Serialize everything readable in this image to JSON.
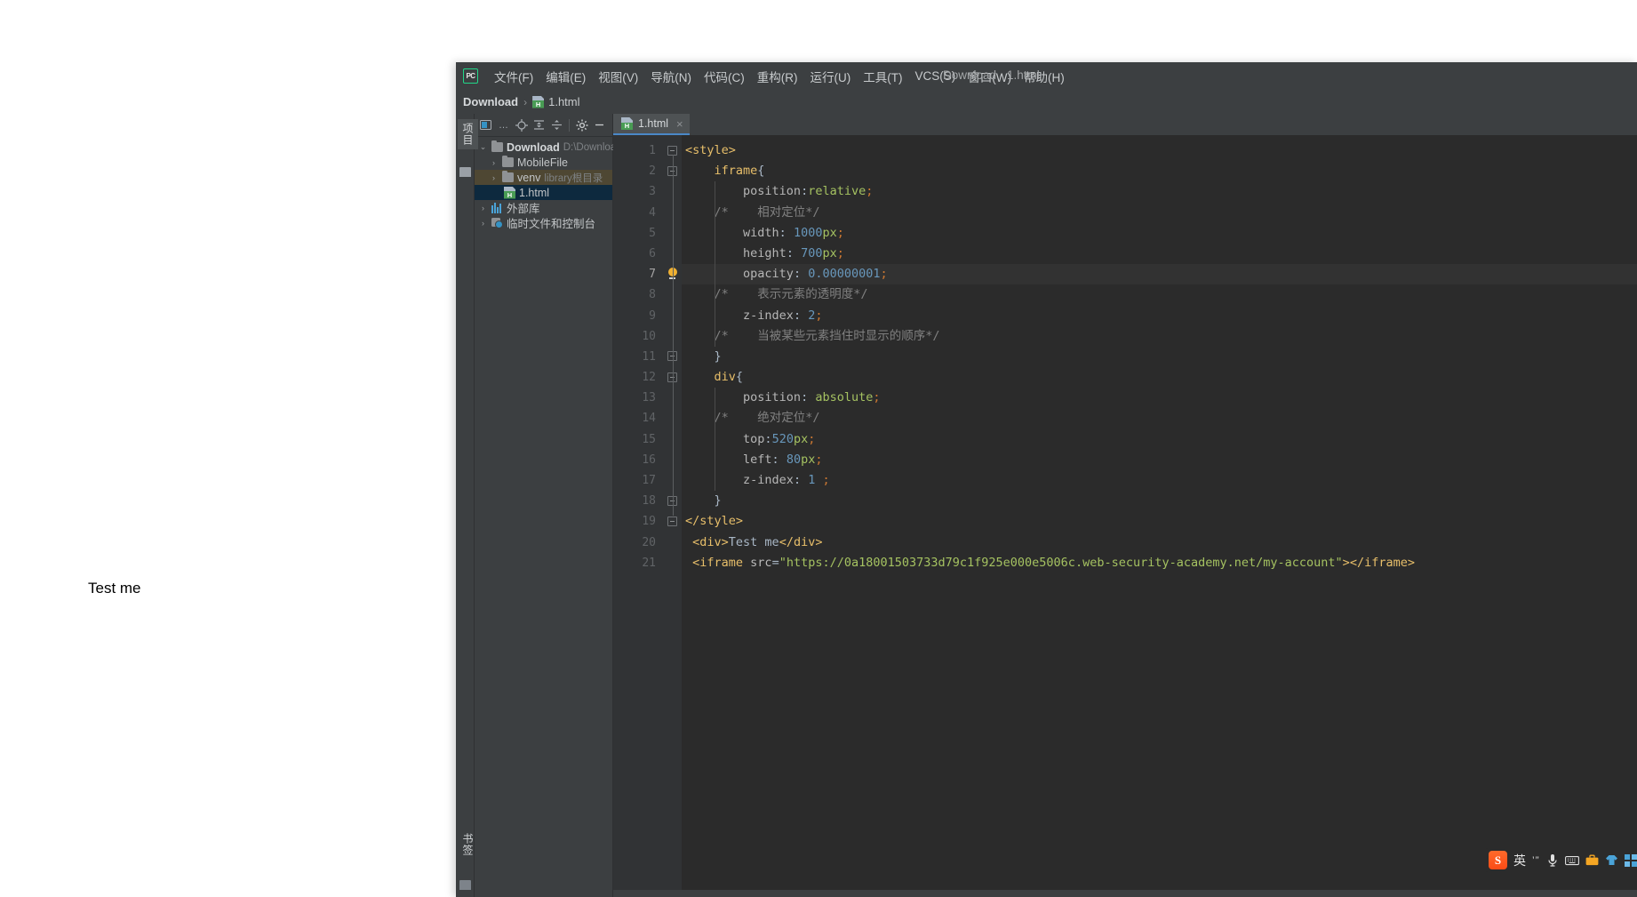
{
  "background_page": {
    "text": "Test me"
  },
  "window": {
    "title": "Download - 1.html",
    "app_logo": "PC"
  },
  "menubar": {
    "items": [
      {
        "label": "文件(F)",
        "name": "menu-file"
      },
      {
        "label": "编辑(E)",
        "name": "menu-edit"
      },
      {
        "label": "视图(V)",
        "name": "menu-view"
      },
      {
        "label": "导航(N)",
        "name": "menu-navigate"
      },
      {
        "label": "代码(C)",
        "name": "menu-code"
      },
      {
        "label": "重构(R)",
        "name": "menu-refactor"
      },
      {
        "label": "运行(U)",
        "name": "menu-run"
      },
      {
        "label": "工具(T)",
        "name": "menu-tools"
      },
      {
        "label": "VCS(S)",
        "name": "menu-vcs"
      },
      {
        "label": "窗口(W)",
        "name": "menu-window"
      },
      {
        "label": "帮助(H)",
        "name": "menu-help"
      }
    ]
  },
  "breadcrumb": {
    "root": "Download",
    "separator": "›",
    "file": "1.html"
  },
  "toolstrip": {
    "project_tab": "项目",
    "bookmarks_tab": "书签"
  },
  "project_panel": {
    "toolbar_icons": [
      "select-opened-file-icon",
      "ellipsis-icon",
      "locate-icon",
      "expand-all-icon",
      "collapse-all-icon",
      "settings-gear-icon",
      "hide-panel-icon"
    ],
    "tree": [
      {
        "label": "Download",
        "hint": "D:\\Download",
        "arrow": "⌄",
        "icon": "folder-icon",
        "state": "expanded",
        "bold": true,
        "indent": 0
      },
      {
        "label": "MobileFile",
        "hint": "",
        "arrow": "›",
        "icon": "folder-icon",
        "state": "collapsed",
        "bold": false,
        "indent": 1
      },
      {
        "label": "venv",
        "hint": "library根目录",
        "arrow": "›",
        "icon": "folder-icon",
        "state": "collapsed",
        "bold": false,
        "indent": 1,
        "highlight": true
      },
      {
        "label": "1.html",
        "hint": "",
        "arrow": "",
        "icon": "html-file-icon",
        "state": "selected",
        "bold": false,
        "indent": 2,
        "selected": true
      },
      {
        "label": "外部库",
        "hint": "",
        "arrow": "›",
        "icon": "library-icon",
        "state": "collapsed",
        "bold": false,
        "indent": 0
      },
      {
        "label": "临时文件和控制台",
        "hint": "",
        "arrow": "›",
        "icon": "scratches-icon",
        "state": "collapsed",
        "bold": false,
        "indent": 0
      }
    ]
  },
  "editor": {
    "active_tab": "1.html",
    "close_label": "×",
    "current_line": 7,
    "lines": [
      {
        "n": 1,
        "fold": "start",
        "tokens": [
          {
            "t": "<style>",
            "c": "t-tag"
          }
        ]
      },
      {
        "n": 2,
        "fold": "start",
        "tokens": [
          {
            "t": "    ",
            "c": "t-punc"
          },
          {
            "t": "iframe",
            "c": "t-sel"
          },
          {
            "t": "{",
            "c": "t-brace"
          }
        ]
      },
      {
        "n": 3,
        "fold": "",
        "tokens": [
          {
            "t": "        ",
            "c": "t-punc"
          },
          {
            "t": "position",
            "c": "t-prop"
          },
          {
            "t": ":",
            "c": "t-punc"
          },
          {
            "t": "relative",
            "c": "t-val"
          },
          {
            "t": ";",
            "c": "t-semi"
          }
        ]
      },
      {
        "n": 4,
        "fold": "",
        "tokens": [
          {
            "t": "    /*    相对定位*/",
            "c": "t-cmt"
          }
        ]
      },
      {
        "n": 5,
        "fold": "",
        "tokens": [
          {
            "t": "        ",
            "c": "t-punc"
          },
          {
            "t": "width",
            "c": "t-prop"
          },
          {
            "t": ": ",
            "c": "t-punc"
          },
          {
            "t": "1000",
            "c": "t-num"
          },
          {
            "t": "px",
            "c": "t-unit"
          },
          {
            "t": ";",
            "c": "t-semi"
          }
        ]
      },
      {
        "n": 6,
        "fold": "",
        "tokens": [
          {
            "t": "        ",
            "c": "t-punc"
          },
          {
            "t": "height",
            "c": "t-prop"
          },
          {
            "t": ": ",
            "c": "t-punc"
          },
          {
            "t": "700",
            "c": "t-num"
          },
          {
            "t": "px",
            "c": "t-unit"
          },
          {
            "t": ";",
            "c": "t-semi"
          }
        ]
      },
      {
        "n": 7,
        "fold": "bulb",
        "current": true,
        "tokens": [
          {
            "t": "        ",
            "c": "t-punc"
          },
          {
            "t": "opacity",
            "c": "t-prop"
          },
          {
            "t": ": ",
            "c": "t-punc"
          },
          {
            "t": "0.00000001",
            "c": "t-num"
          },
          {
            "t": ";",
            "c": "t-semi"
          }
        ]
      },
      {
        "n": 8,
        "fold": "",
        "tokens": [
          {
            "t": "    /*    表示元素的透明度*/",
            "c": "t-cmt"
          }
        ]
      },
      {
        "n": 9,
        "fold": "",
        "tokens": [
          {
            "t": "        ",
            "c": "t-punc"
          },
          {
            "t": "z-index",
            "c": "t-prop"
          },
          {
            "t": ": ",
            "c": "t-punc"
          },
          {
            "t": "2",
            "c": "t-num"
          },
          {
            "t": ";",
            "c": "t-semi"
          }
        ]
      },
      {
        "n": 10,
        "fold": "",
        "tokens": [
          {
            "t": "    /*    当被某些元素挡住时显示的顺序*/",
            "c": "t-cmt"
          }
        ]
      },
      {
        "n": 11,
        "fold": "end",
        "tokens": [
          {
            "t": "    ",
            "c": "t-punc"
          },
          {
            "t": "}",
            "c": "t-brace"
          }
        ]
      },
      {
        "n": 12,
        "fold": "start",
        "tokens": [
          {
            "t": "    ",
            "c": "t-punc"
          },
          {
            "t": "div",
            "c": "t-sel"
          },
          {
            "t": "{",
            "c": "t-brace"
          }
        ]
      },
      {
        "n": 13,
        "fold": "",
        "tokens": [
          {
            "t": "        ",
            "c": "t-punc"
          },
          {
            "t": "position",
            "c": "t-prop"
          },
          {
            "t": ": ",
            "c": "t-punc"
          },
          {
            "t": "absolute",
            "c": "t-val"
          },
          {
            "t": ";",
            "c": "t-semi"
          }
        ]
      },
      {
        "n": 14,
        "fold": "",
        "tokens": [
          {
            "t": "    /*    绝对定位*/",
            "c": "t-cmt"
          }
        ]
      },
      {
        "n": 15,
        "fold": "",
        "tokens": [
          {
            "t": "        ",
            "c": "t-punc"
          },
          {
            "t": "top",
            "c": "t-prop"
          },
          {
            "t": ":",
            "c": "t-punc"
          },
          {
            "t": "520",
            "c": "t-num"
          },
          {
            "t": "px",
            "c": "t-unit"
          },
          {
            "t": ";",
            "c": "t-semi"
          }
        ]
      },
      {
        "n": 16,
        "fold": "",
        "tokens": [
          {
            "t": "        ",
            "c": "t-punc"
          },
          {
            "t": "left",
            "c": "t-prop"
          },
          {
            "t": ": ",
            "c": "t-punc"
          },
          {
            "t": "80",
            "c": "t-num"
          },
          {
            "t": "px",
            "c": "t-unit"
          },
          {
            "t": ";",
            "c": "t-semi"
          }
        ]
      },
      {
        "n": 17,
        "fold": "",
        "tokens": [
          {
            "t": "        ",
            "c": "t-punc"
          },
          {
            "t": "z-index",
            "c": "t-prop"
          },
          {
            "t": ": ",
            "c": "t-punc"
          },
          {
            "t": "1",
            "c": "t-num"
          },
          {
            "t": " ;",
            "c": "t-semi"
          }
        ]
      },
      {
        "n": 18,
        "fold": "end",
        "tokens": [
          {
            "t": "    ",
            "c": "t-punc"
          },
          {
            "t": "}",
            "c": "t-brace"
          }
        ]
      },
      {
        "n": 19,
        "fold": "end",
        "tokens": [
          {
            "t": "</style>",
            "c": "t-tag"
          }
        ]
      },
      {
        "n": 20,
        "fold": "",
        "tokens": [
          {
            "t": " ",
            "c": "t-punc"
          },
          {
            "t": "<div>",
            "c": "t-tag"
          },
          {
            "t": "Test me",
            "c": "t-punc"
          },
          {
            "t": "</div>",
            "c": "t-tag"
          }
        ]
      },
      {
        "n": 21,
        "fold": "",
        "tokens": [
          {
            "t": " ",
            "c": "t-punc"
          },
          {
            "t": "<iframe",
            "c": "t-tag"
          },
          {
            "t": " src",
            "c": "t-attr"
          },
          {
            "t": "=",
            "c": "t-eq"
          },
          {
            "t": "\"https://0a18001503733d79c1f925e000e5006c.web-security-academy.net/my-account\"",
            "c": "t-str"
          },
          {
            "t": ">",
            "c": "t-tag"
          },
          {
            "t": "</iframe>",
            "c": "t-tag"
          }
        ]
      }
    ]
  },
  "ime_toolbar": {
    "logo": "S",
    "mode_label": "英",
    "punct_label": "’”",
    "icons": [
      "microphone-icon",
      "keyboard-icon",
      "toolbox-icon",
      "skin-icon",
      "apps-icon"
    ]
  },
  "colors": {
    "ide_chrome": "#3c3f41",
    "editor_bg": "#2b2b2b",
    "gutter_bg": "#313335",
    "tab_accent": "#4a88c7",
    "selection": "#0d293e",
    "highlight": "#4e4733",
    "logo_green": "#21d789",
    "ime_orange": "#fb4b16"
  }
}
